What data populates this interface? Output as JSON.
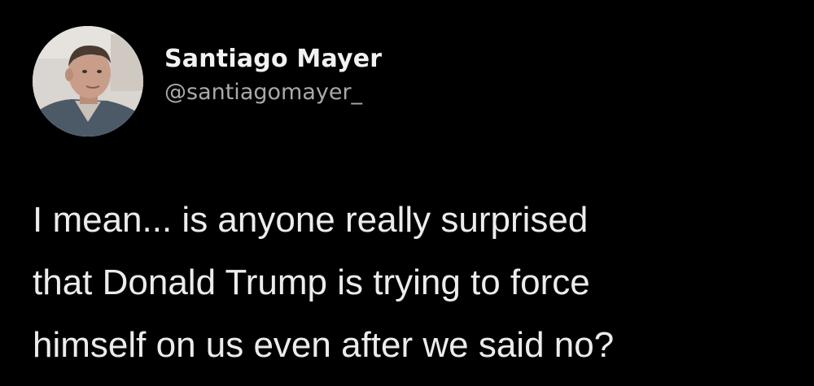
{
  "author": {
    "display_name": "Santiago Mayer",
    "handle": "@santiagomayer_",
    "avatar_icon": "profile-photo"
  },
  "tweet": {
    "text": "I mean... is anyone really surprised\nthat Donald Trump is trying to force\nhimself on us even after we said no?"
  },
  "colors": {
    "background": "#000000",
    "name": "#f2f2f2",
    "handle": "#a7aaad",
    "text": "#ececec"
  }
}
